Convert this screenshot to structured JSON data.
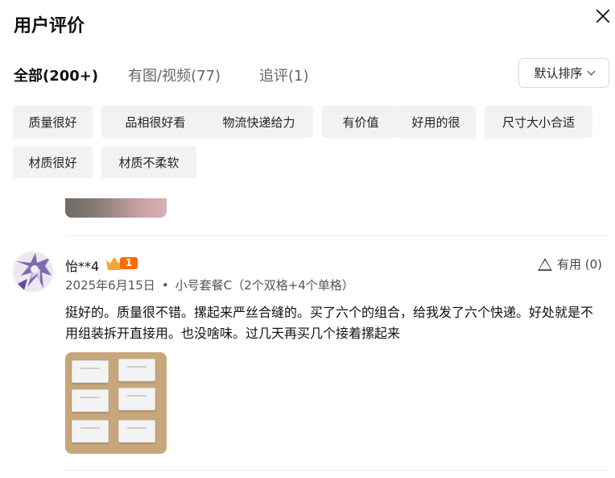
{
  "header": {
    "title": "用户评价"
  },
  "tabs": [
    {
      "label": "全部(200+)",
      "active": true
    },
    {
      "label": "有图/视频(77)",
      "active": false
    },
    {
      "label": "追评(1)",
      "active": false
    }
  ],
  "sort": {
    "label": "默认排序"
  },
  "tags": [
    "质量很好",
    "品相很好看",
    "物流快递给力",
    "有价值",
    "好用的很",
    "尺寸大小合适",
    "材质很好",
    "材质不柔软"
  ],
  "review": {
    "username": "怡**4",
    "level": "1",
    "helpful": "有用 (0)",
    "date": "2025年6月15日",
    "dot": "•",
    "variant": "小号套餐C（2个双格+4个单格）",
    "text": "挺好的。质量很不错。摞起来严丝合缝的。买了六个的组合，给我发了六个快递。好处就是不用组装拆开直接用。也没啥味。过几天再买几个接着摞起来"
  },
  "colors": {
    "badge": "#ff6a00",
    "tag_bg": "#f2f2f2"
  }
}
